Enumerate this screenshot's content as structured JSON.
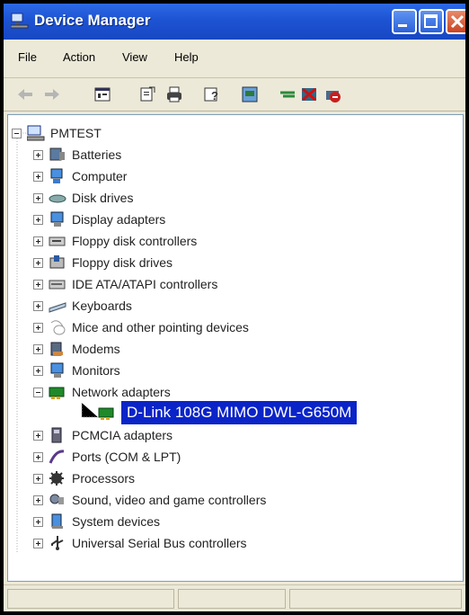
{
  "window": {
    "title": "Device Manager"
  },
  "menu": [
    "File",
    "Action",
    "View",
    "Help"
  ],
  "toolbar_icons": [
    "back-icon",
    "forward-icon",
    "properties-icon",
    "scan-icon",
    "print-icon",
    "help-icon",
    "update-icon",
    "uninstall-icon",
    "disable-icon",
    "remove-icon"
  ],
  "tree": {
    "root": "PMTEST",
    "categories": [
      {
        "label": "Batteries",
        "icon": "battery-icon"
      },
      {
        "label": "Computer",
        "icon": "computer-icon"
      },
      {
        "label": "Disk drives",
        "icon": "disk-icon"
      },
      {
        "label": "Display adapters",
        "icon": "display-icon"
      },
      {
        "label": "Floppy disk controllers",
        "icon": "floppy-controller-icon"
      },
      {
        "label": "Floppy disk drives",
        "icon": "floppy-drive-icon"
      },
      {
        "label": "IDE ATA/ATAPI controllers",
        "icon": "ide-icon"
      },
      {
        "label": "Keyboards",
        "icon": "keyboard-icon"
      },
      {
        "label": "Mice and other pointing devices",
        "icon": "mouse-icon"
      },
      {
        "label": "Modems",
        "icon": "modem-icon"
      },
      {
        "label": "Monitors",
        "icon": "monitor-icon"
      },
      {
        "label": "Network adapters",
        "icon": "network-icon",
        "expanded": true,
        "children": [
          {
            "label": "D-Link 108G MIMO DWL-G650M",
            "icon": "network-card-icon",
            "selected": true
          }
        ]
      },
      {
        "label": "PCMCIA adapters",
        "icon": "pcmcia-icon"
      },
      {
        "label": "Ports (COM & LPT)",
        "icon": "ports-icon"
      },
      {
        "label": "Processors",
        "icon": "processor-icon"
      },
      {
        "label": "Sound, video and game controllers",
        "icon": "sound-icon"
      },
      {
        "label": "System devices",
        "icon": "system-icon"
      },
      {
        "label": "Universal Serial Bus controllers",
        "icon": "usb-icon"
      }
    ]
  },
  "colors": {
    "titlebar": "#1d53d3",
    "selection": "#0b24c8",
    "chrome": "#ece9d8"
  }
}
